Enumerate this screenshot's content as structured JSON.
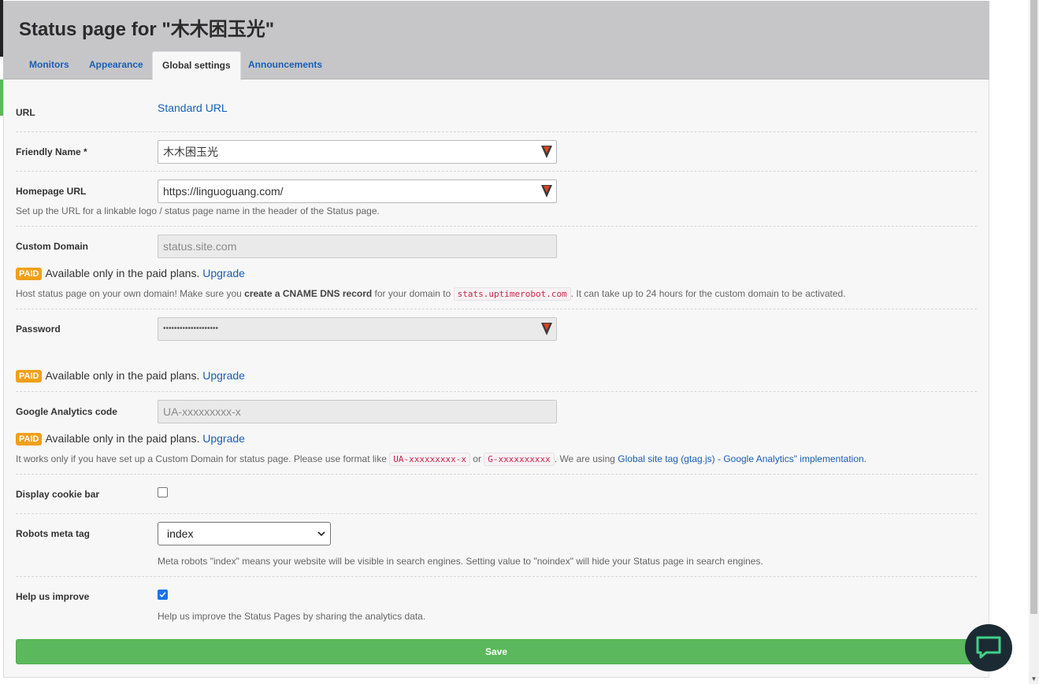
{
  "page": {
    "title": "Status page for \"木木困玉光\""
  },
  "tabs": [
    {
      "label": "Monitors"
    },
    {
      "label": "Appearance"
    },
    {
      "label": "Global settings"
    },
    {
      "label": "Announcements"
    }
  ],
  "url": {
    "label": "URL",
    "link": "Standard URL"
  },
  "friendly_name": {
    "label": "Friendly Name *",
    "value": "木木困玉光"
  },
  "homepage_url": {
    "label": "Homepage URL",
    "value": "https://linguoguang.com/",
    "help": "Set up the URL for a linkable logo / status page name in the header of the Status page."
  },
  "custom_domain": {
    "label": "Custom Domain",
    "placeholder": "status.site.com",
    "help_before": "Host status page on your own domain! Make sure you ",
    "help_bold": "create a CNAME DNS record",
    "help_mid": " for your domain to ",
    "help_code": "stats.uptimerobot.com",
    "help_after": ". It can take up to 24 hours for the custom domain to be activated."
  },
  "paid": {
    "badge": "PAID",
    "text": "Available only in the paid plans.",
    "link": "Upgrade"
  },
  "password": {
    "label": "Password",
    "value": "••••••••••••••••••••"
  },
  "google_analytics": {
    "label": "Google Analytics code",
    "placeholder": "UA-xxxxxxxxx-x",
    "help_before": "It works only if you have set up a Custom Domain for status page. Please use format like ",
    "code1": "UA-xxxxxxxxx-x",
    "help_or": " or ",
    "code2": "G-xxxxxxxxxx",
    "help_mid": ". We are using ",
    "help_link": "Global site tag (gtag.js) - Google Analytics\" implementation."
  },
  "cookie_bar": {
    "label": "Display cookie bar",
    "checked": false
  },
  "robots": {
    "label": "Robots meta tag",
    "selected": "index",
    "help": "Meta robots \"index\" means your website will be visible in search engines. Setting value to \"noindex\" will hide your Status page in search engines."
  },
  "help_improve": {
    "label": "Help us improve",
    "checked": true,
    "help": "Help us improve the Status Pages by sharing the analytics data."
  },
  "save_label": "Save",
  "colors": {
    "accent_link": "#1a5fb4",
    "save_green": "#5cb85c",
    "paid_orange": "#f0a01a",
    "header_gray": "#c6c6c8"
  }
}
